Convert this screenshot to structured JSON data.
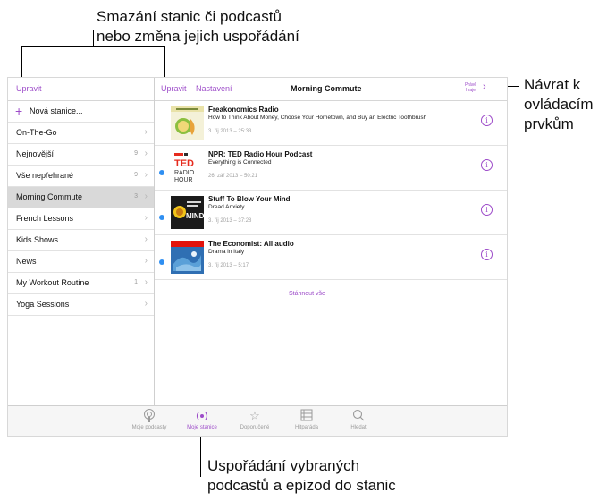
{
  "annotations": {
    "top_line1": "Smazání stanic či podcastů",
    "top_line2": "nebo změna jejich uspořádání",
    "right_line1": "Návrat k",
    "right_line2": "ovládacím",
    "right_line3": "prvkům",
    "bottom_line1": "Uspořádání vybraných",
    "bottom_line2": "podcastů a epizod do stanic"
  },
  "colors": {
    "accent": "#9d4cc9",
    "unplayed_dot": "#2f8ff2",
    "selected_row": "#d9d9d9"
  },
  "sidebar": {
    "edit_label": "Upravit",
    "new_station_label": "Nová stanice...",
    "items": [
      {
        "label": "On-The-Go",
        "count": ""
      },
      {
        "label": "Nejnovější",
        "count": "9"
      },
      {
        "label": "Vše nepřehrané",
        "count": "9"
      },
      {
        "label": "Morning Commute",
        "count": "3"
      },
      {
        "label": "French Lessons",
        "count": ""
      },
      {
        "label": "Kids Shows",
        "count": ""
      },
      {
        "label": "News",
        "count": ""
      },
      {
        "label": "My Workout Routine",
        "count": "1"
      },
      {
        "label": "Yoga Sessions",
        "count": ""
      }
    ]
  },
  "main": {
    "edit_label": "Upravit",
    "settings_label": "Nastavení",
    "title": "Morning Commute",
    "now_playing_line1": "Právě",
    "now_playing_line2": "hraje",
    "download_all_label": "Stáhnout vše",
    "episodes": [
      {
        "title": "Freakonomics Radio",
        "subtitle": "How to Think About Money, Choose Your Hometown, and Buy an Electric Toothbrush",
        "meta": "3. říj 2013 – 25:33",
        "unplayed": false,
        "artwork": "freakonomics-artwork"
      },
      {
        "title": "NPR: TED Radio Hour Podcast",
        "subtitle": "Everything is Connected",
        "meta": "26. zář 2013 – 50:21",
        "unplayed": true,
        "artwork": "ted-radio-hour-artwork",
        "art_text": [
          "TED",
          "RADIO",
          "HOUR"
        ]
      },
      {
        "title": "Stuff To Blow Your Mind",
        "subtitle": "Dread Anxiety",
        "meta": "3. říj 2013 – 37:28",
        "unplayed": true,
        "artwork": "stuff-to-blow-your-mind-artwork",
        "art_text": [
          "MIND"
        ]
      },
      {
        "title": "The Economist: All audio",
        "subtitle": "Drama in Italy",
        "meta": "3. říj 2013 – 5:17",
        "unplayed": true,
        "artwork": "economist-artwork"
      }
    ]
  },
  "tabbar": {
    "tabs": [
      {
        "label": "Moje podcasty",
        "icon": "podcast-icon",
        "active": false
      },
      {
        "label": "Moje stanice",
        "icon": "station-icon",
        "active": true
      },
      {
        "label": "Doporučené",
        "icon": "star-icon",
        "active": false
      },
      {
        "label": "Hitparáda",
        "icon": "list-icon",
        "active": false
      },
      {
        "label": "Hledat",
        "icon": "search-icon",
        "active": false
      }
    ]
  }
}
